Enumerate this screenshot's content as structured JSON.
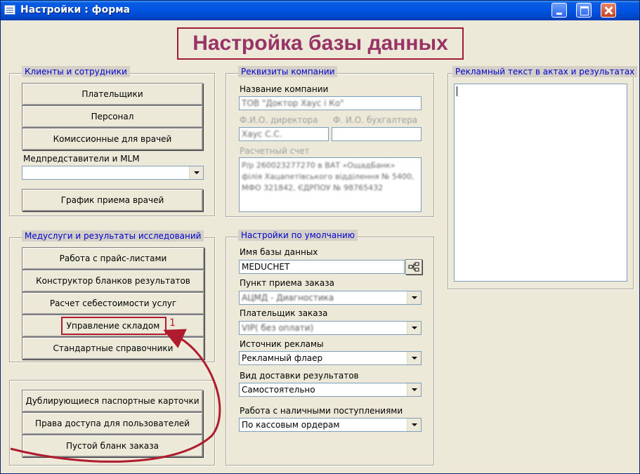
{
  "window": {
    "title": "Настройки : форма"
  },
  "heading": "Настройка базы данных",
  "clients": {
    "title": "Клиенты и сотрудники",
    "buttons": [
      "Плательщики",
      "Персонал",
      "Комиссионные для врачей"
    ],
    "medrep_label": "Медпредставители и MLM",
    "medrep_value": "",
    "schedule_button": "График приема врачей"
  },
  "services": {
    "title": "Медуслуги и результаты исследований",
    "buttons": [
      "Работа с прайс-листами",
      "Конструктор бланков результатов",
      "Расчет себестоимости услуг",
      "Управление складом",
      "Стандартные справочники"
    ]
  },
  "misc": {
    "buttons": [
      "Дублирующиеся паспортные карточки",
      "Права доступа для пользователей",
      "Пустой бланк заказа"
    ]
  },
  "company": {
    "title": "Реквизиты компании",
    "name_label": "Название компании",
    "name_value": "ТОВ \"Доктор Хаус і Ко\"",
    "director_label": "Ф.И.О. директора",
    "accountant_label": "Ф. И.О. бухгалтера",
    "director_value": "Хаус С.С.",
    "accountant_value": "",
    "account_label": "Расчетный счет",
    "account_lines": [
      "Р/р 260023277270 в ВАТ «ОщадБанк»",
      "філія Хацапетівського відділення № 5400,",
      "МФО 321842, ЄДРПОУ № 98765432"
    ]
  },
  "defaults": {
    "title": "Настройки по умолчанию",
    "db_label": "Имя базы данных",
    "db_value": "MEDUCHET",
    "order_point_label": "Пункт приема заказа",
    "order_point_value": "АЦМД - Диагностика",
    "payer_label": "Плательщик заказа",
    "payer_value": "VIP( без оплати)",
    "ad_source_label": "Источник рекламы",
    "ad_source_value": "Рекламный флаер",
    "delivery_label": "Вид доставки результатов",
    "delivery_value": "Самостоятельно",
    "cash_label": "Работа с наличными поступлениями",
    "cash_value": "По кассовым ордерам"
  },
  "ad": {
    "title": "Рекламный текст в актах и результатах",
    "value": ""
  },
  "annotation": {
    "marker": "1",
    "color": "#b01c2e"
  }
}
